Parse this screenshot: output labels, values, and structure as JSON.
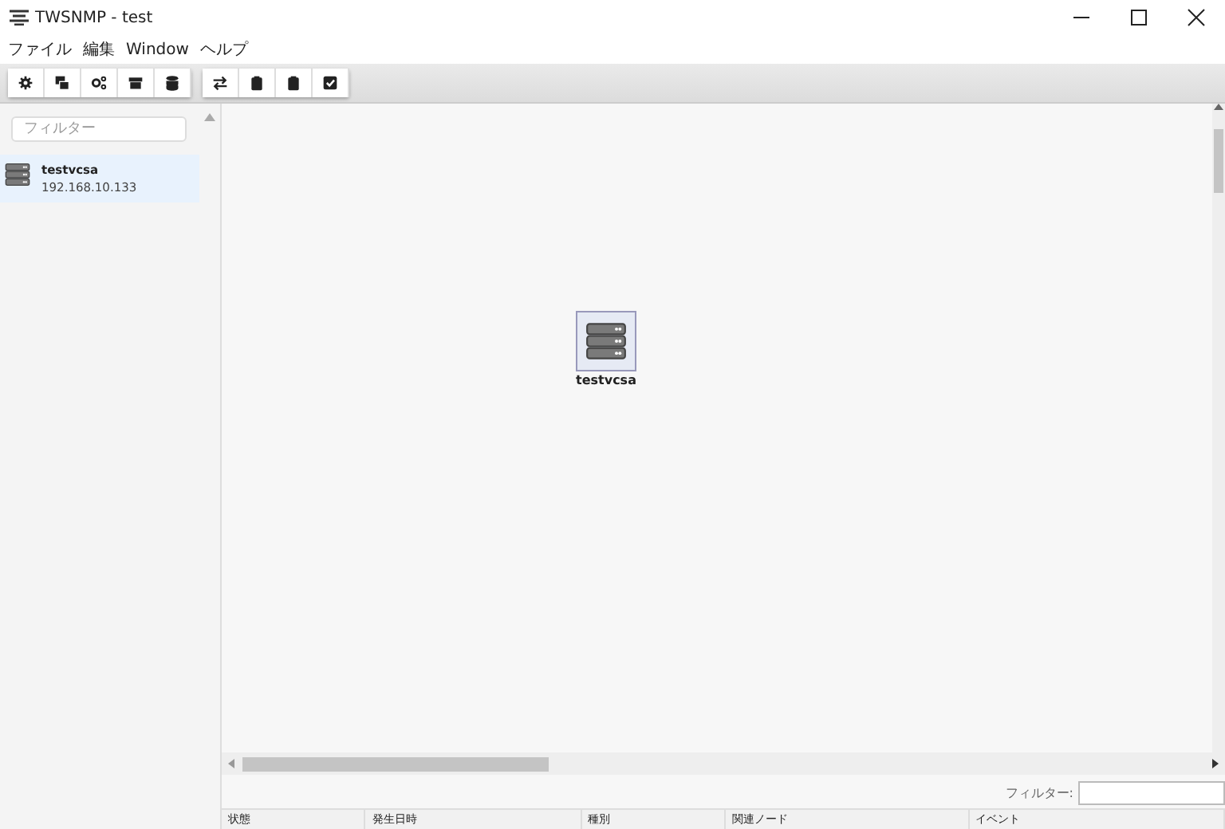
{
  "window": {
    "title": "TWSNMP - test"
  },
  "menu": [
    "ファイル",
    "編集",
    "Window",
    "ヘルプ"
  ],
  "toolbar": {
    "groups": [
      [
        {
          "kind": "gear"
        },
        {
          "kind": "node"
        },
        {
          "kind": "gears"
        },
        {
          "kind": "archive"
        },
        {
          "kind": "database"
        }
      ],
      [
        {
          "kind": "exchange"
        },
        {
          "kind": "clipboard"
        },
        {
          "kind": "clipboard"
        },
        {
          "kind": "check"
        }
      ]
    ]
  },
  "sidebar": {
    "filter": {
      "placeholder": "フィルター"
    },
    "nodes": [
      {
        "name": "testvcsa",
        "ip": "192.168.10.133",
        "selected": true
      }
    ]
  },
  "map": {
    "nodes": [
      {
        "label": "testvcsa",
        "selected": true
      }
    ]
  },
  "log": {
    "filter_label": "フィルター:",
    "columns": [
      "状態",
      "発生日時",
      "種別",
      "関連ノード",
      "イベント"
    ]
  }
}
